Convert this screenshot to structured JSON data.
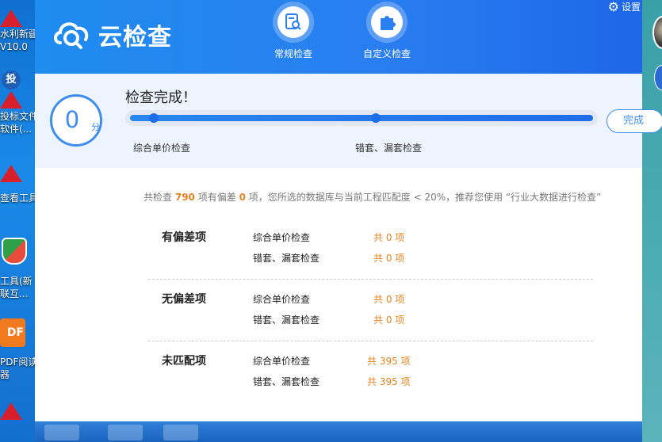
{
  "desktop": {
    "icons": [
      {
        "label1": "水利新疆",
        "label2": "V10.0"
      },
      {
        "label1": "投",
        "label2": ""
      },
      {
        "label1": "投标文件",
        "label2": "软件(..."
      },
      {
        "label1": "查看工具",
        "label2": ""
      },
      {
        "label1": "工具(新",
        "label2": "联互..."
      },
      {
        "label1": "PDF阅读",
        "label2": "器"
      }
    ],
    "pdf_icon_text": "DF"
  },
  "app": {
    "title": "云检查",
    "settings_label": "设置",
    "nav": [
      {
        "label": "常规检查",
        "icon": "document-search-icon"
      },
      {
        "label": "自定义检查",
        "icon": "puzzle-icon"
      }
    ]
  },
  "progress": {
    "score": "0",
    "score_unit": "分",
    "status": "检查完成！",
    "done_button": "完成",
    "stages": [
      "综合单价检查",
      "错套、漏套检查"
    ],
    "fill_fraction": 1.0
  },
  "summary": {
    "prefix": "共检查",
    "total": "790",
    "mid": "项有偏差",
    "deviations": "0",
    "suffix": "项，您所选的数据库与当前工程匹配度 < 20%，推荐您使用 “行业大数据进行检查”"
  },
  "groups": [
    {
      "title": "有偏差项",
      "rows": [
        {
          "name": "综合单价检查",
          "count": "共 0 项"
        },
        {
          "name": "错套、漏套检查",
          "count": "共 0 项"
        }
      ]
    },
    {
      "title": "无偏差项",
      "rows": [
        {
          "name": "综合单价检查",
          "count": "共 0 项"
        },
        {
          "name": "错套、漏套检查",
          "count": "共 0 项"
        }
      ]
    },
    {
      "title": "未匹配项",
      "rows": [
        {
          "name": "综合单价检查",
          "count": "共 395 项"
        },
        {
          "name": "错套、漏套检查",
          "count": "共 395 项"
        }
      ]
    }
  ],
  "colors": {
    "accent": "#1f6ee9",
    "highlight": "#e6821e"
  }
}
